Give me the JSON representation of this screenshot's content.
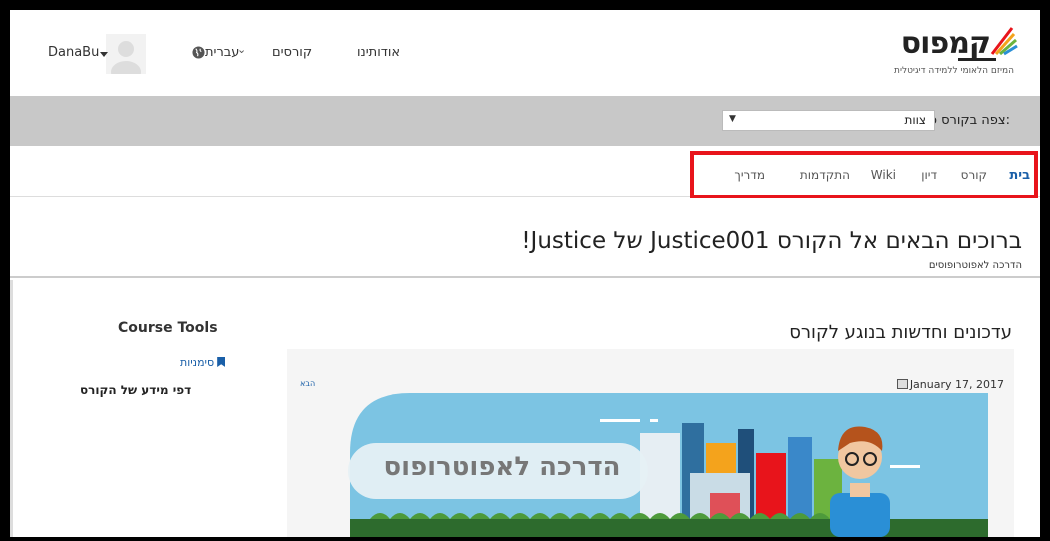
{
  "header": {
    "logo_text": "קמפוס",
    "logo_subtitle": "המיזם הלאומי ללמידה דיגיטלית",
    "nav": {
      "about": "אודותינו",
      "courses": "קורסים",
      "language": "עברית"
    },
    "user": {
      "username": "DanaBu"
    }
  },
  "course_bar": {
    "label": "צפה בקורס כ:",
    "select_value": "צוות"
  },
  "tabs": {
    "home": "בית",
    "course": "קורס",
    "discussion": "דיון",
    "wiki": "Wiki",
    "progress": "התקדמות",
    "guide": "מדריך"
  },
  "welcome": {
    "title": "ברוכים הבאים אל הקורס Justice001 של Justice!",
    "subtitle": "הדרכה לאפוטרופוסים"
  },
  "content": {
    "updates_title": "עדכונים וחדשות בנוגע לקורס",
    "card_date": "January 17, 2017",
    "card_more": "הבא",
    "banner_text": "הדרכה לאפוטרופוס"
  },
  "sidebar": {
    "tools_title": "Course Tools",
    "bookmarks": "סימניות",
    "info_pages": "דפי מידע של הקורס"
  },
  "colors": {
    "accent": "#1a5fa8",
    "highlight": "#e8141b",
    "bar_gray": "#c8c8c8",
    "banner_sky": "#7cc4e3"
  }
}
